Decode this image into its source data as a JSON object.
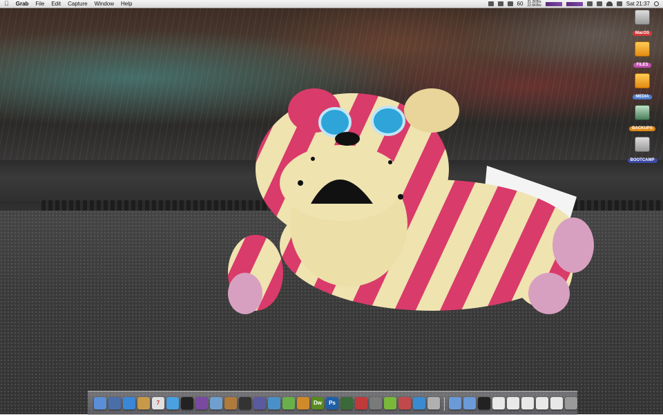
{
  "menubar": {
    "apple": "",
    "items": [
      "Grab",
      "File",
      "Edit",
      "Capture",
      "Window",
      "Help"
    ],
    "battery": "60",
    "net_up": "31.2KB/s",
    "net_down": "22.6KB/s",
    "clock": "Sat 21:37"
  },
  "desktop_icons": [
    {
      "label": "MacOS",
      "color": "#d23b3b",
      "icon": "hard-drive-icon"
    },
    {
      "label": "FILES",
      "color": "#c050b0",
      "icon": "usb-drive-icon"
    },
    {
      "label": "MEDIA",
      "color": "#4d7fd1",
      "icon": "usb-drive-icon"
    },
    {
      "label": "BACKUPS",
      "color": "#e08a18",
      "icon": "time-machine-drive-icon"
    },
    {
      "label": "BOOTCAMP",
      "color": "#3d4aa8",
      "icon": "hard-drive-icon"
    }
  ],
  "toy_tag": "Bagpuss",
  "dock": {
    "apps": [
      {
        "name": "finder-icon",
        "color": "#5a8fd8",
        "glyph": ""
      },
      {
        "name": "preview-icon",
        "color": "#4a6ea8",
        "glyph": ""
      },
      {
        "name": "safari-icon",
        "color": "#3a87d8",
        "glyph": ""
      },
      {
        "name": "address-book-icon",
        "color": "#c79a4a",
        "glyph": ""
      },
      {
        "name": "ical-icon",
        "color": "#e0e0e0",
        "glyph": "7"
      },
      {
        "name": "itunes-icon",
        "color": "#4aa0e0",
        "glyph": ""
      },
      {
        "name": "terminal-icon",
        "color": "#222222",
        "glyph": ""
      },
      {
        "name": "photo-app-icon",
        "color": "#7a4aa0",
        "glyph": ""
      },
      {
        "name": "iphoto-icon",
        "color": "#6f9fcf",
        "glyph": ""
      },
      {
        "name": "guitar-icon",
        "color": "#b07a3a",
        "glyph": ""
      },
      {
        "name": "clapper-icon",
        "color": "#333333",
        "glyph": ""
      },
      {
        "name": "pen-icon",
        "color": "#5a5aa0",
        "glyph": ""
      },
      {
        "name": "chart-app-icon",
        "color": "#4a90c8",
        "glyph": ""
      },
      {
        "name": "frog-icon",
        "color": "#6ab04a",
        "glyph": ""
      },
      {
        "name": "fireworks-icon",
        "color": "#d08a2a",
        "glyph": ""
      },
      {
        "name": "dreamweaver-icon",
        "color": "#5a8a20",
        "glyph": "Dw"
      },
      {
        "name": "photoshop-icon",
        "color": "#1f5fa8",
        "glyph": "Ps"
      },
      {
        "name": "fugu-icon",
        "color": "#3a6a3a",
        "glyph": ""
      },
      {
        "name": "screen-sharing-icon",
        "color": "#c03a3a",
        "glyph": ""
      },
      {
        "name": "calculator-icon",
        "color": "#7a7a7a",
        "glyph": ""
      },
      {
        "name": "android-icon",
        "color": "#7ab83a",
        "glyph": ""
      },
      {
        "name": "colorful-app-icon",
        "color": "#c04a4a",
        "glyph": ""
      },
      {
        "name": "cyberduck-icon",
        "color": "#3a8ad0",
        "glyph": ""
      },
      {
        "name": "keychain-icon",
        "color": "#b0b0b0",
        "glyph": ""
      }
    ],
    "stacks": [
      {
        "name": "folder-icon",
        "color": "#6a9ad8",
        "glyph": ""
      },
      {
        "name": "folder-icon",
        "color": "#6a9ad8",
        "glyph": ""
      },
      {
        "name": "document-stack-icon",
        "color": "#222222",
        "glyph": ""
      },
      {
        "name": "document-icon",
        "color": "#e8e8e8",
        "glyph": ""
      },
      {
        "name": "document-icon",
        "color": "#e8e8e8",
        "glyph": ""
      },
      {
        "name": "document-icon",
        "color": "#e8e8e8",
        "glyph": ""
      },
      {
        "name": "document-icon",
        "color": "#e8e8e8",
        "glyph": ""
      },
      {
        "name": "document-icon",
        "color": "#e8e8e8",
        "glyph": ""
      },
      {
        "name": "trash-icon",
        "color": "#9a9a9a",
        "glyph": ""
      }
    ]
  }
}
